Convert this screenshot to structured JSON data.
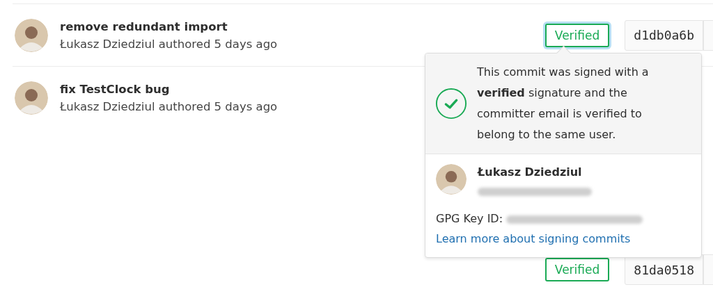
{
  "commits": [
    {
      "title": "remove redundant import",
      "meta": "Łukasz Dziedziul authored 5 days ago",
      "badge": {
        "label": "Verified",
        "focused": true
      },
      "sha": "d1db0a6b"
    },
    {
      "title": "fix TestClock bug",
      "meta": "Łukasz Dziedziul authored 5 days ago"
    },
    {
      "badge": {
        "label": "Verified",
        "focused": false
      },
      "sha": "81da0518"
    }
  ],
  "popover": {
    "message": "This commit was signed with a **verified** signature and the committer email is verified to belong to the same user.",
    "signer": "Łukasz Dziedziul",
    "key_label": "GPG Key ID:",
    "link": "Learn more about signing commits"
  }
}
